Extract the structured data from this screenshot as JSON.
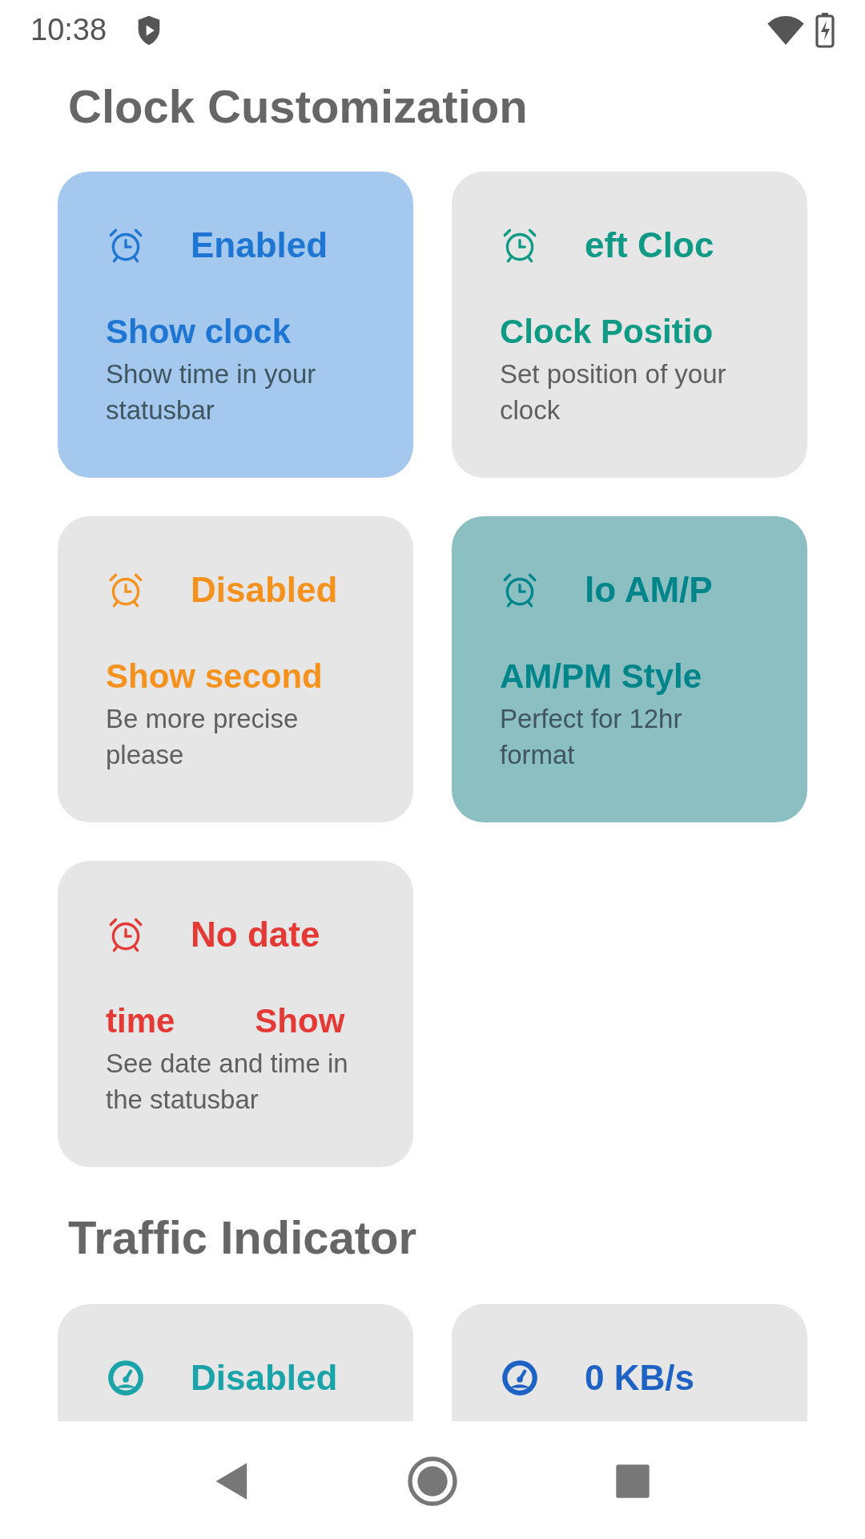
{
  "status_bar": {
    "time": "10:38"
  },
  "sections": [
    {
      "title": "Clock Customization",
      "kind": "clock",
      "cards": [
        {
          "status": "Enabled",
          "title_parts": [
            "Show clock"
          ],
          "description": "Show time in your statusbar",
          "color": "#1e76d2",
          "selected": true
        },
        {
          "status": "eft Cloc",
          "title_parts": [
            "Clock Positio"
          ],
          "description": "Set position of your clock",
          "color": "#0f9a86",
          "selected": false
        },
        {
          "status": "Disabled",
          "title_parts": [
            "Show second"
          ],
          "description": "Be more precise please",
          "color": "#f5921e",
          "selected": false
        },
        {
          "status": "lo AM/P",
          "title_parts": [
            "AM/PM Style"
          ],
          "description": "Perfect for 12hr format",
          "color": "#00868a",
          "selected": true
        },
        {
          "status": "No date",
          "title_parts": [
            "time",
            "Show"
          ],
          "description": "See date and time in the statusbar",
          "color": "#e53935",
          "selected": false
        }
      ]
    },
    {
      "title": "Traffic Indicator",
      "kind": "traffic",
      "cards": [
        {
          "status": "Disabled",
          "color": "#1aa3a8",
          "selected": false
        },
        {
          "status": "0 KB/s",
          "color": "#1e63c4",
          "selected": false
        }
      ]
    }
  ]
}
